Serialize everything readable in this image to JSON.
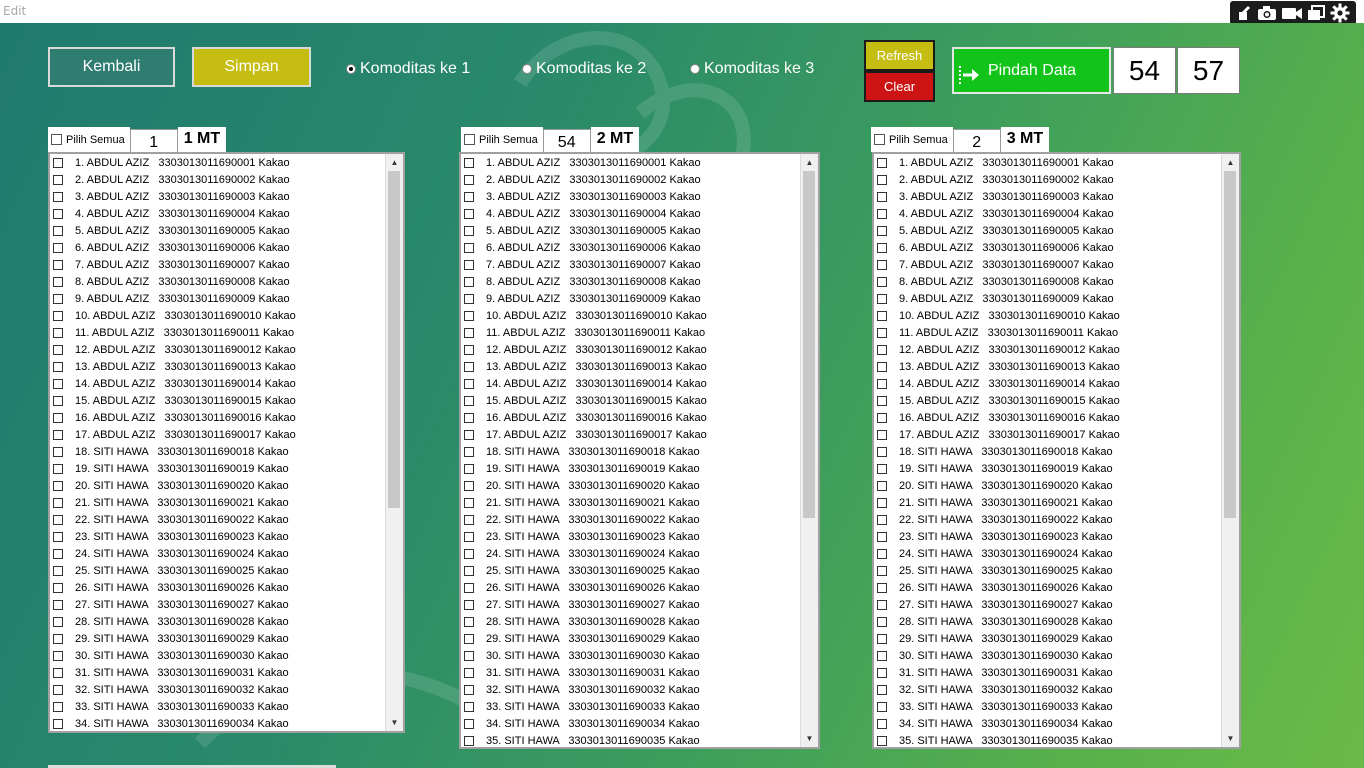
{
  "window": {
    "title": "Edit"
  },
  "toolbar": {
    "icons": [
      "edit-pencil-icon",
      "camera-icon",
      "video-icon",
      "window-icon",
      "gear-icon"
    ]
  },
  "buttons": {
    "kembali": "Kembali",
    "simpan": "Simpan",
    "refresh": "Refresh",
    "clear": "Clear",
    "pindah": "Pindah Data"
  },
  "radios": [
    {
      "label": "Komoditas  ke 1",
      "selected": true
    },
    {
      "label": "Komoditas ke 2",
      "selected": false
    },
    {
      "label": "Komoditas  ke 3",
      "selected": false
    }
  ],
  "counters": {
    "left": "54",
    "right": "57"
  },
  "lists": [
    {
      "pilih_semua": "Pilih Semua",
      "number": "1",
      "mt": "1 MT",
      "visible_rows": 34,
      "scroll_thumb": 0.62
    },
    {
      "pilih_semua": "Pilih Semua",
      "number": "54",
      "mt": "2 MT",
      "visible_rows": 35,
      "scroll_thumb": 0.62
    },
    {
      "pilih_semua": "Pilih Semua",
      "number": "2",
      "mt": "3 MT",
      "visible_rows": 35,
      "scroll_thumb": 0.62
    }
  ],
  "rows": [
    "1. ABDUL AZIZ   3303013011690001 Kakao",
    "2. ABDUL AZIZ   3303013011690002 Kakao",
    "3. ABDUL AZIZ   3303013011690003 Kakao",
    "4. ABDUL AZIZ   3303013011690004 Kakao",
    "5. ABDUL AZIZ   3303013011690005 Kakao",
    "6. ABDUL AZIZ   3303013011690006 Kakao",
    "7. ABDUL AZIZ   3303013011690007 Kakao",
    "8. ABDUL AZIZ   3303013011690008 Kakao",
    "9. ABDUL AZIZ   3303013011690009 Kakao",
    "10. ABDUL AZIZ   3303013011690010 Kakao",
    "11. ABDUL AZIZ   3303013011690011 Kakao",
    "12. ABDUL AZIZ   3303013011690012 Kakao",
    "13. ABDUL AZIZ   3303013011690013 Kakao",
    "14. ABDUL AZIZ   3303013011690014 Kakao",
    "15. ABDUL AZIZ   3303013011690015 Kakao",
    "16. ABDUL AZIZ   3303013011690016 Kakao",
    "17. ABDUL AZIZ   3303013011690017 Kakao",
    "18. SITI HAWA   3303013011690018 Kakao",
    "19. SITI HAWA   3303013011690019 Kakao",
    "20. SITI HAWA   3303013011690020 Kakao",
    "21. SITI HAWA   3303013011690021 Kakao",
    "22. SITI HAWA   3303013011690022 Kakao",
    "23. SITI HAWA   3303013011690023 Kakao",
    "24. SITI HAWA   3303013011690024 Kakao",
    "25. SITI HAWA   3303013011690025 Kakao",
    "26. SITI HAWA   3303013011690026 Kakao",
    "27. SITI HAWA   3303013011690027 Kakao",
    "28. SITI HAWA   3303013011690028 Kakao",
    "29. SITI HAWA   3303013011690029 Kakao",
    "30. SITI HAWA   3303013011690030 Kakao",
    "31. SITI HAWA   3303013011690031 Kakao",
    "32. SITI HAWA   3303013011690032 Kakao",
    "33. SITI HAWA   3303013011690033 Kakao",
    "34. SITI HAWA   3303013011690034 Kakao",
    "35. SITI HAWA   3303013011690035 Kakao"
  ],
  "colors": {
    "simpan": "#c5bd12",
    "clear": "#cc1414",
    "pindah": "#12c41a",
    "kembali": "#2e7d70"
  }
}
